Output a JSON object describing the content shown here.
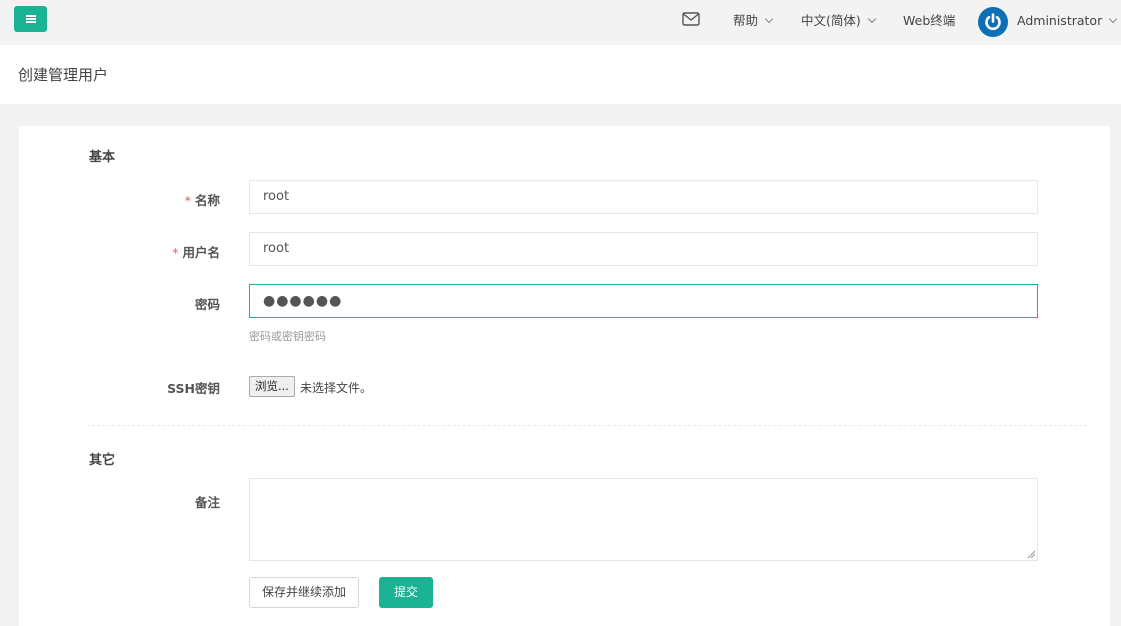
{
  "topbar": {
    "help_label": "帮助",
    "language_label": "中文(简体)",
    "web_terminal_label": "Web终端",
    "user_name": "Administrator"
  },
  "page": {
    "title": "创建管理用户"
  },
  "form": {
    "section_basic": "基本",
    "section_other": "其它",
    "required_mark": "*",
    "name_label": "名称",
    "name_value": "root",
    "username_label": "用户名",
    "username_value": "root",
    "password_label": "密码",
    "password_masked": "●●●●●●",
    "password_help": "密码或密钥密码",
    "ssh_key_label": "SSH密钥",
    "file_button_label": "浏览...",
    "file_status": "未选择文件。",
    "comment_label": "备注",
    "save_continue_label": "保存并继续添加",
    "submit_label": "提交"
  },
  "colors": {
    "accent": "#1ab394",
    "required": "#ed5565",
    "avatar": "#0d6fb5"
  },
  "icons": [
    "menu-icon",
    "mail-icon",
    "chevron-down-icon",
    "power-icon",
    "resize-grip-icon"
  ]
}
